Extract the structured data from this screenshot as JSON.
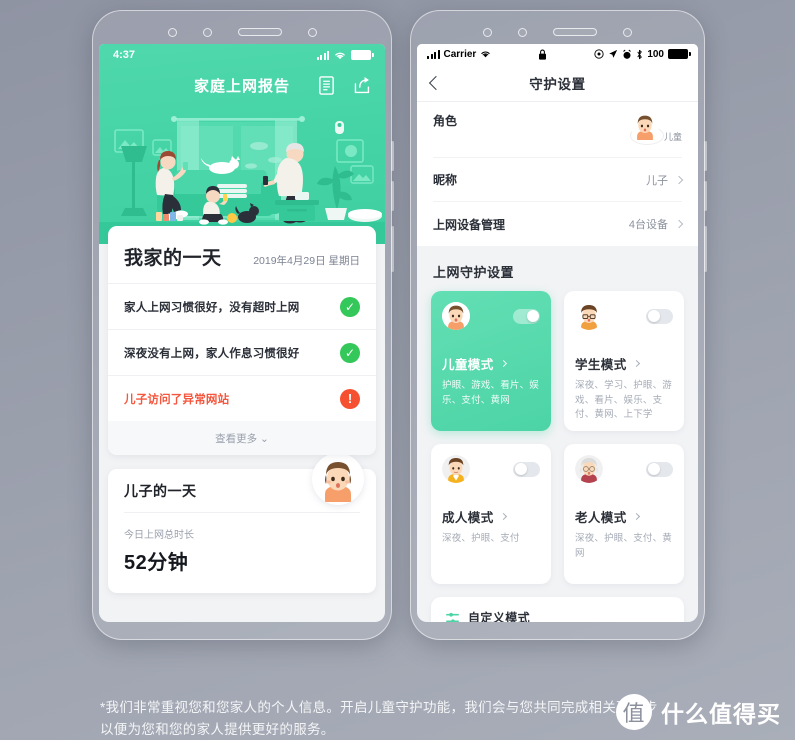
{
  "left_phone": {
    "status_bar": {
      "time": "4:37",
      "signal_icon": "signal-bars-icon",
      "wifi_icon": "wifi-icon",
      "battery_icon": "battery-icon"
    },
    "header": {
      "title": "家庭上网报告",
      "report_icon": "document-report-icon",
      "share_icon": "share-icon"
    },
    "illustration": "family-living-room-illustration",
    "report_card": {
      "title": "我家的一天",
      "date": "2019年4月29日 星期日",
      "rows": [
        {
          "text": "家人上网习惯很好，没有超时上网",
          "status": "ok",
          "badge": "✓"
        },
        {
          "text": "深夜没有上网，家人作息习惯很好",
          "status": "ok",
          "badge": "✓"
        },
        {
          "text": "儿子访问了异常网站",
          "status": "alert",
          "badge": "!"
        }
      ],
      "more_label": "查看更多 ⌄"
    },
    "child_card": {
      "title": "儿子的一天",
      "subtitle": "今日上网总时长",
      "duration": "52分钟",
      "avatar_icon": "boy-avatar-icon"
    }
  },
  "right_phone": {
    "status_bar": {
      "carrier": "Carrier",
      "signal_icon": "signal-bars-icon",
      "wifi_icon": "wifi-icon",
      "lock_icon": "lock-icon",
      "location_icon": "location-icon",
      "navigation_icon": "navigation-arrow-icon",
      "alarm_icon": "alarm-clock-icon",
      "bluetooth_icon": "bluetooth-icon",
      "battery_percent": "100",
      "battery_icon": "battery-icon"
    },
    "navbar": {
      "back_icon": "chevron-left-icon",
      "title": "守护设置"
    },
    "settings": [
      {
        "label": "角色",
        "value": "儿童",
        "type": "avatar",
        "avatar_icon": "boy-avatar-icon"
      },
      {
        "label": "昵称",
        "value": "儿子",
        "type": "chevron"
      },
      {
        "label": "上网设备管理",
        "value": "4台设备",
        "type": "chevron"
      }
    ],
    "section_title": "上网守护设置",
    "modes": [
      {
        "name": "儿童模式",
        "desc": "护眼、游戏、看片、娱乐、支付、黄网",
        "enabled": true,
        "avatar_icon": "child-avatar-icon"
      },
      {
        "name": "学生模式",
        "desc": "深夜、学习、护眼、游戏、看片、娱乐、支付、黄网、上下学",
        "enabled": false,
        "avatar_icon": "student-avatar-icon"
      },
      {
        "name": "成人模式",
        "desc": "深夜、护眼、支付",
        "enabled": false,
        "avatar_icon": "adult-avatar-icon"
      },
      {
        "name": "老人模式",
        "desc": "深夜、护眼、支付、黄网",
        "enabled": false,
        "avatar_icon": "elder-avatar-icon"
      }
    ],
    "custom_mode": {
      "label": "自定义模式",
      "icon": "custom-settings-icon"
    }
  },
  "footer": {
    "line1": "*我们非常重视您和您家人的个人信息。开启儿童守护功能，我们会与您共同完成相关确认步",
    "line2": "以便为您和您的家人提供更好的服务。"
  },
  "watermark": {
    "logo_glyph": "值",
    "text": "什么值得买"
  },
  "colors": {
    "brand_green": "#4cd4a6",
    "hero_green": "#44d3a5",
    "alert_red": "#f5502f",
    "ok_green": "#34c759",
    "page_bg": "#9ba0ad"
  }
}
